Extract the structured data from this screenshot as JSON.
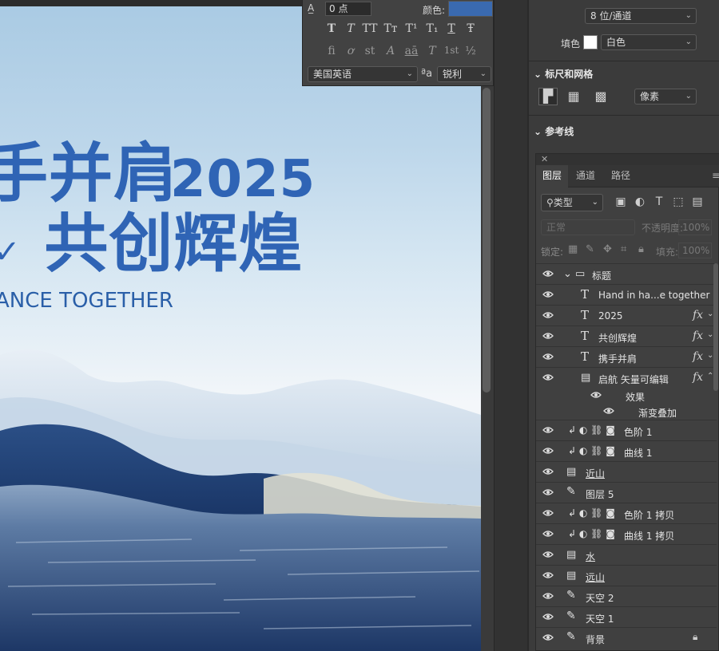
{
  "canvas": {
    "title_line1": "手并肩",
    "year": "2025",
    "title_line2": "共创辉煌",
    "english": "ANCE TOGETHER"
  },
  "char_panel": {
    "kern_icon": "tracking-icon",
    "kern_value": "0 点",
    "color_label": "颜色:",
    "color": "#3a6ab0",
    "style_buttons": [
      "T",
      "T",
      "TT",
      "Tт",
      "T¹",
      "T₁",
      "T",
      "Ŧ"
    ],
    "opentype_buttons": [
      "fi",
      "ơ",
      "st",
      "A",
      "aā",
      "T",
      "1st",
      "½"
    ],
    "language": "美国英语",
    "aa_label": "ªa",
    "antialias": "锐利"
  },
  "right_panel": {
    "bit_depth": "8 位/通道",
    "fill_label": "填色",
    "fill_value": "白色",
    "rulers_title": "标尺和网格",
    "units": "像素",
    "guides_title": "参考线"
  },
  "layers_panel": {
    "tabs": [
      "图层",
      "通道",
      "路径"
    ],
    "filter": "类型",
    "blend_mode": "正常",
    "opacity_label": "不透明度:",
    "opacity_value": "100%",
    "lock_label": "锁定:",
    "fill_label": "填充:",
    "fill_value": "100%",
    "layers": [
      {
        "name": "标题",
        "kind": "group"
      },
      {
        "name": "Hand in ha...e together",
        "kind": "text"
      },
      {
        "name": "2025",
        "kind": "text",
        "fx": true
      },
      {
        "name": "共创辉煌",
        "kind": "text",
        "fx": true
      },
      {
        "name": "携手并肩",
        "kind": "text",
        "fx": true
      },
      {
        "name": "启航 矢量可编辑",
        "kind": "smart",
        "fx": true
      },
      {
        "name": "效果",
        "kind": "effect"
      },
      {
        "name": "渐变叠加",
        "kind": "effect"
      },
      {
        "name": "色阶 1",
        "kind": "adjust"
      },
      {
        "name": "曲线 1",
        "kind": "adjust"
      },
      {
        "name": "近山",
        "kind": "smart"
      },
      {
        "name": "图层 5",
        "kind": "brush"
      },
      {
        "name": "色阶 1 拷贝",
        "kind": "adjust"
      },
      {
        "name": "曲线 1 拷贝",
        "kind": "adjust"
      },
      {
        "name": "水",
        "kind": "smart"
      },
      {
        "name": "远山",
        "kind": "smart"
      },
      {
        "name": "天空 2",
        "kind": "brush"
      },
      {
        "name": "天空 1",
        "kind": "brush"
      },
      {
        "name": "背景",
        "kind": "brush",
        "locked": true
      }
    ]
  }
}
